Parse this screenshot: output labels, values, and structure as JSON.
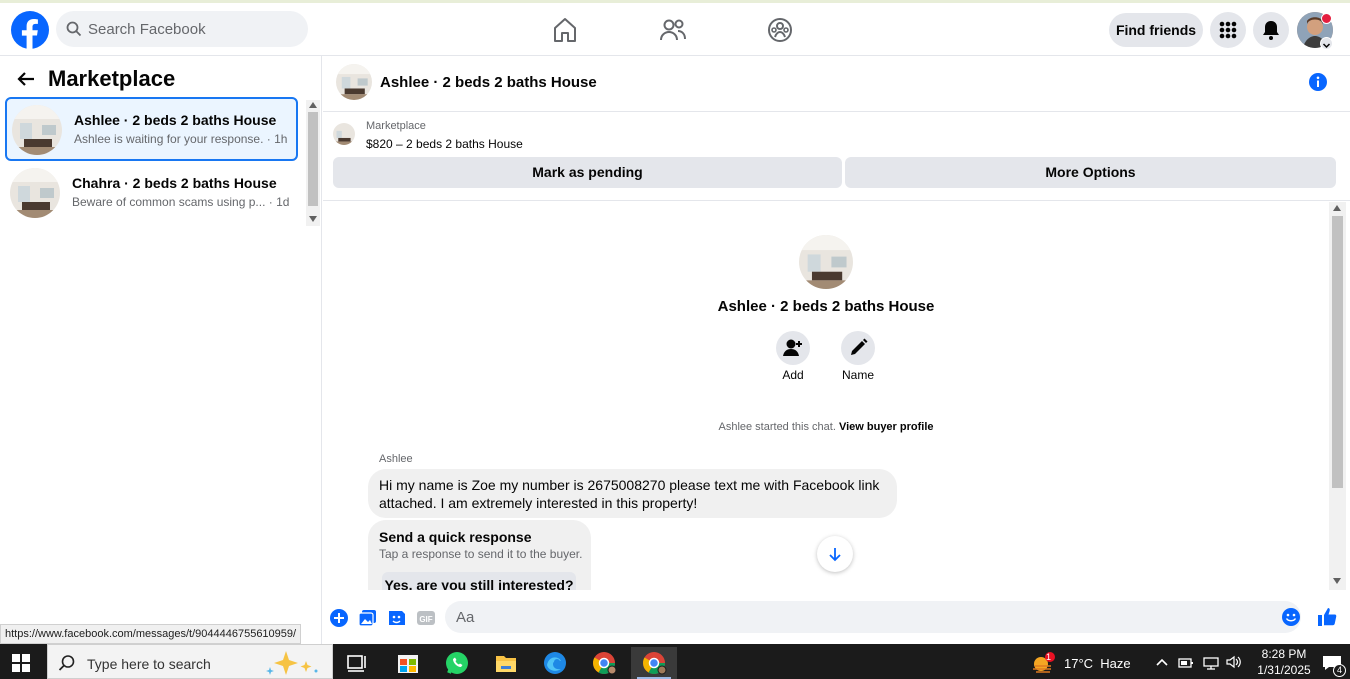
{
  "topbar": {
    "search_placeholder": "Search Facebook",
    "find_friends_label": "Find friends"
  },
  "left_panel": {
    "title": "Marketplace",
    "conversations": [
      {
        "title": "Ashlee · 2 beds 2 baths House",
        "subtitle": "Ashlee is waiting for your response. · 1h",
        "active": true
      },
      {
        "title": "Chahra · 2 beds 2 baths House",
        "subtitle": "Beware of common scams using p... · 1d",
        "active": false
      }
    ]
  },
  "chat": {
    "title": "Ashlee · 2 beds 2 baths House",
    "listing_category": "Marketplace",
    "listing_price": "$820 – 2 beds 2 baths House",
    "mark_pending_label": "Mark as pending",
    "more_options_label": "More Options",
    "center_title": "Ashlee · 2 beds 2 baths House",
    "add_label": "Add",
    "name_label": "Name",
    "started_text": "Ashlee started this chat.",
    "view_profile_label": "View buyer profile",
    "sender_name": "Ashlee",
    "message_text": "Hi my name is Zoe my number is 2675008270 please text me with Facebook link attached. I am extremely interested in this property!",
    "quick_title": "Send a quick response",
    "quick_subtitle": "Tap a response to send it to the buyer.",
    "quick_option": "Yes, are you still interested?",
    "composer_placeholder": "Aa"
  },
  "status_url": "https://www.facebook.com/messages/t/9044446755610959/",
  "taskbar": {
    "search_text": "Type here to search",
    "weather": "17°C  Haze",
    "weather_badge": "1",
    "time": "8:28 PM",
    "date": "1/31/2025",
    "notification_count": "4"
  },
  "colors": {
    "brand_blue": "#0866ff",
    "accent": "#1877f2",
    "surface": "#f0f2f5",
    "button_gray": "#e4e6eb"
  }
}
